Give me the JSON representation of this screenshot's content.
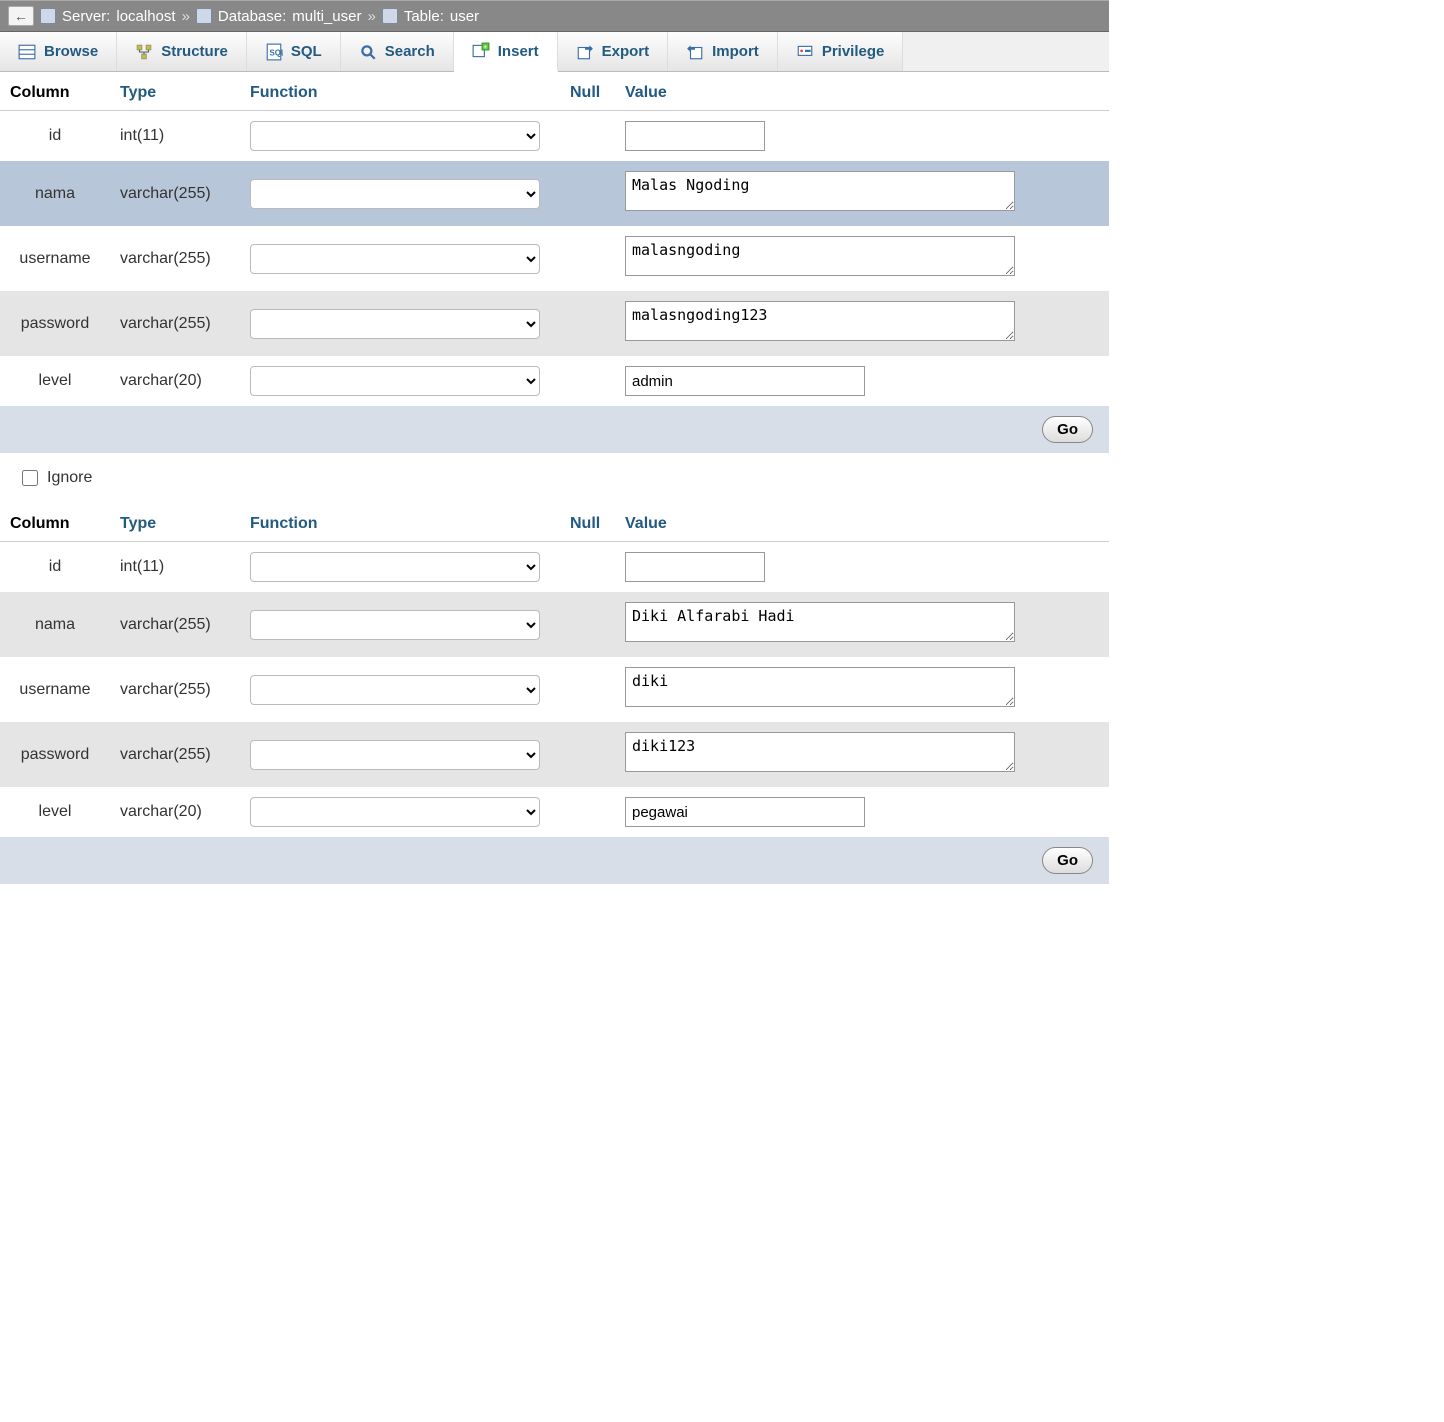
{
  "breadcrumb": {
    "server_label": "Server:",
    "server_value": "localhost",
    "db_label": "Database:",
    "db_value": "multi_user",
    "table_label": "Table:",
    "table_value": "user"
  },
  "tabs": {
    "browse": "Browse",
    "structure": "Structure",
    "sql": "SQL",
    "search": "Search",
    "insert": "Insert",
    "export": "Export",
    "import": "Import",
    "privileges": "Privilege"
  },
  "headers": {
    "column": "Column",
    "type": "Type",
    "function": "Function",
    "null": "Null",
    "value": "Value"
  },
  "buttons": {
    "go": "Go",
    "ignore": "Ignore"
  },
  "rows1": [
    {
      "column": "id",
      "type": "int(11)",
      "value": "",
      "kind": "short",
      "hl": false
    },
    {
      "column": "nama",
      "type": "varchar(255)",
      "value": "Malas Ngoding",
      "kind": "long",
      "hl": true
    },
    {
      "column": "username",
      "type": "varchar(255)",
      "value": "malasngoding",
      "kind": "long",
      "hl": false
    },
    {
      "column": "password",
      "type": "varchar(255)",
      "value": "malasngoding123",
      "kind": "long",
      "hl": false,
      "spell": true
    },
    {
      "column": "level",
      "type": "varchar(20)",
      "value": "admin",
      "kind": "med",
      "hl": false
    }
  ],
  "rows2": [
    {
      "column": "id",
      "type": "int(11)",
      "value": "",
      "kind": "short"
    },
    {
      "column": "nama",
      "type": "varchar(255)",
      "value": "Diki Alfarabi Hadi",
      "kind": "long"
    },
    {
      "column": "username",
      "type": "varchar(255)",
      "value": "diki",
      "kind": "long"
    },
    {
      "column": "password",
      "type": "varchar(255)",
      "value": "diki123",
      "kind": "long"
    },
    {
      "column": "level",
      "type": "varchar(20)",
      "value": "pegawai",
      "kind": "med"
    }
  ]
}
